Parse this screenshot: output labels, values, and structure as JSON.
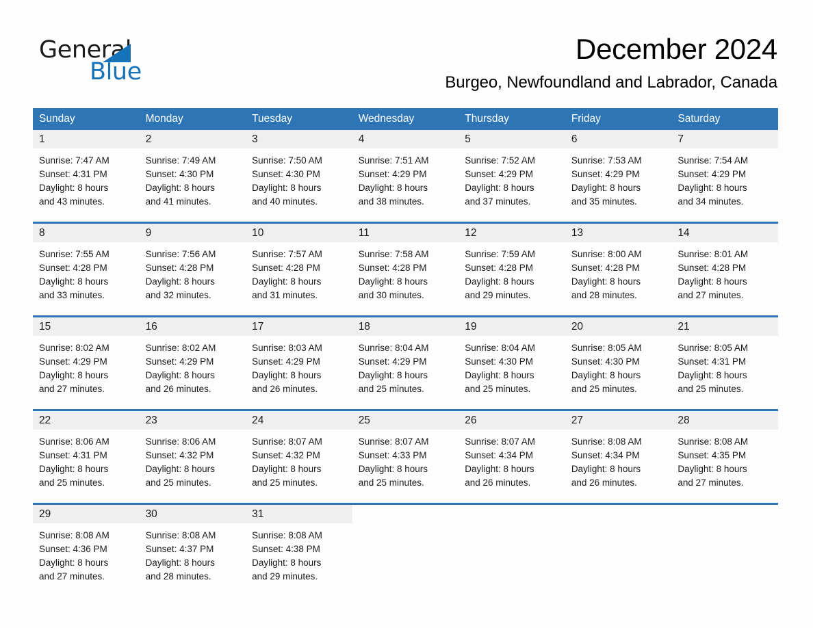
{
  "brand": {
    "name_part1": "General",
    "name_part2": "Blue",
    "logo_triangle_color": "#1673b8"
  },
  "header": {
    "month_title": "December 2024",
    "location": "Burgeo, Newfoundland and Labrador, Canada"
  },
  "theme": {
    "header_blue": "#2e75b6",
    "daynum_band": "#efefef",
    "page_background": "#fdfdfd",
    "text": "#1a1a1a"
  },
  "calendar": {
    "weekdays": [
      "Sunday",
      "Monday",
      "Tuesday",
      "Wednesday",
      "Thursday",
      "Friday",
      "Saturday"
    ],
    "weeks": [
      [
        {
          "day": "1",
          "sunrise": "Sunrise: 7:47 AM",
          "sunset": "Sunset: 4:31 PM",
          "daylight_line1": "Daylight: 8 hours",
          "daylight_line2": "and 43 minutes."
        },
        {
          "day": "2",
          "sunrise": "Sunrise: 7:49 AM",
          "sunset": "Sunset: 4:30 PM",
          "daylight_line1": "Daylight: 8 hours",
          "daylight_line2": "and 41 minutes."
        },
        {
          "day": "3",
          "sunrise": "Sunrise: 7:50 AM",
          "sunset": "Sunset: 4:30 PM",
          "daylight_line1": "Daylight: 8 hours",
          "daylight_line2": "and 40 minutes."
        },
        {
          "day": "4",
          "sunrise": "Sunrise: 7:51 AM",
          "sunset": "Sunset: 4:29 PM",
          "daylight_line1": "Daylight: 8 hours",
          "daylight_line2": "and 38 minutes."
        },
        {
          "day": "5",
          "sunrise": "Sunrise: 7:52 AM",
          "sunset": "Sunset: 4:29 PM",
          "daylight_line1": "Daylight: 8 hours",
          "daylight_line2": "and 37 minutes."
        },
        {
          "day": "6",
          "sunrise": "Sunrise: 7:53 AM",
          "sunset": "Sunset: 4:29 PM",
          "daylight_line1": "Daylight: 8 hours",
          "daylight_line2": "and 35 minutes."
        },
        {
          "day": "7",
          "sunrise": "Sunrise: 7:54 AM",
          "sunset": "Sunset: 4:29 PM",
          "daylight_line1": "Daylight: 8 hours",
          "daylight_line2": "and 34 minutes."
        }
      ],
      [
        {
          "day": "8",
          "sunrise": "Sunrise: 7:55 AM",
          "sunset": "Sunset: 4:28 PM",
          "daylight_line1": "Daylight: 8 hours",
          "daylight_line2": "and 33 minutes."
        },
        {
          "day": "9",
          "sunrise": "Sunrise: 7:56 AM",
          "sunset": "Sunset: 4:28 PM",
          "daylight_line1": "Daylight: 8 hours",
          "daylight_line2": "and 32 minutes."
        },
        {
          "day": "10",
          "sunrise": "Sunrise: 7:57 AM",
          "sunset": "Sunset: 4:28 PM",
          "daylight_line1": "Daylight: 8 hours",
          "daylight_line2": "and 31 minutes."
        },
        {
          "day": "11",
          "sunrise": "Sunrise: 7:58 AM",
          "sunset": "Sunset: 4:28 PM",
          "daylight_line1": "Daylight: 8 hours",
          "daylight_line2": "and 30 minutes."
        },
        {
          "day": "12",
          "sunrise": "Sunrise: 7:59 AM",
          "sunset": "Sunset: 4:28 PM",
          "daylight_line1": "Daylight: 8 hours",
          "daylight_line2": "and 29 minutes."
        },
        {
          "day": "13",
          "sunrise": "Sunrise: 8:00 AM",
          "sunset": "Sunset: 4:28 PM",
          "daylight_line1": "Daylight: 8 hours",
          "daylight_line2": "and 28 minutes."
        },
        {
          "day": "14",
          "sunrise": "Sunrise: 8:01 AM",
          "sunset": "Sunset: 4:28 PM",
          "daylight_line1": "Daylight: 8 hours",
          "daylight_line2": "and 27 minutes."
        }
      ],
      [
        {
          "day": "15",
          "sunrise": "Sunrise: 8:02 AM",
          "sunset": "Sunset: 4:29 PM",
          "daylight_line1": "Daylight: 8 hours",
          "daylight_line2": "and 27 minutes."
        },
        {
          "day": "16",
          "sunrise": "Sunrise: 8:02 AM",
          "sunset": "Sunset: 4:29 PM",
          "daylight_line1": "Daylight: 8 hours",
          "daylight_line2": "and 26 minutes."
        },
        {
          "day": "17",
          "sunrise": "Sunrise: 8:03 AM",
          "sunset": "Sunset: 4:29 PM",
          "daylight_line1": "Daylight: 8 hours",
          "daylight_line2": "and 26 minutes."
        },
        {
          "day": "18",
          "sunrise": "Sunrise: 8:04 AM",
          "sunset": "Sunset: 4:29 PM",
          "daylight_line1": "Daylight: 8 hours",
          "daylight_line2": "and 25 minutes."
        },
        {
          "day": "19",
          "sunrise": "Sunrise: 8:04 AM",
          "sunset": "Sunset: 4:30 PM",
          "daylight_line1": "Daylight: 8 hours",
          "daylight_line2": "and 25 minutes."
        },
        {
          "day": "20",
          "sunrise": "Sunrise: 8:05 AM",
          "sunset": "Sunset: 4:30 PM",
          "daylight_line1": "Daylight: 8 hours",
          "daylight_line2": "and 25 minutes."
        },
        {
          "day": "21",
          "sunrise": "Sunrise: 8:05 AM",
          "sunset": "Sunset: 4:31 PM",
          "daylight_line1": "Daylight: 8 hours",
          "daylight_line2": "and 25 minutes."
        }
      ],
      [
        {
          "day": "22",
          "sunrise": "Sunrise: 8:06 AM",
          "sunset": "Sunset: 4:31 PM",
          "daylight_line1": "Daylight: 8 hours",
          "daylight_line2": "and 25 minutes."
        },
        {
          "day": "23",
          "sunrise": "Sunrise: 8:06 AM",
          "sunset": "Sunset: 4:32 PM",
          "daylight_line1": "Daylight: 8 hours",
          "daylight_line2": "and 25 minutes."
        },
        {
          "day": "24",
          "sunrise": "Sunrise: 8:07 AM",
          "sunset": "Sunset: 4:32 PM",
          "daylight_line1": "Daylight: 8 hours",
          "daylight_line2": "and 25 minutes."
        },
        {
          "day": "25",
          "sunrise": "Sunrise: 8:07 AM",
          "sunset": "Sunset: 4:33 PM",
          "daylight_line1": "Daylight: 8 hours",
          "daylight_line2": "and 25 minutes."
        },
        {
          "day": "26",
          "sunrise": "Sunrise: 8:07 AM",
          "sunset": "Sunset: 4:34 PM",
          "daylight_line1": "Daylight: 8 hours",
          "daylight_line2": "and 26 minutes."
        },
        {
          "day": "27",
          "sunrise": "Sunrise: 8:08 AM",
          "sunset": "Sunset: 4:34 PM",
          "daylight_line1": "Daylight: 8 hours",
          "daylight_line2": "and 26 minutes."
        },
        {
          "day": "28",
          "sunrise": "Sunrise: 8:08 AM",
          "sunset": "Sunset: 4:35 PM",
          "daylight_line1": "Daylight: 8 hours",
          "daylight_line2": "and 27 minutes."
        }
      ],
      [
        {
          "day": "29",
          "sunrise": "Sunrise: 8:08 AM",
          "sunset": "Sunset: 4:36 PM",
          "daylight_line1": "Daylight: 8 hours",
          "daylight_line2": "and 27 minutes."
        },
        {
          "day": "30",
          "sunrise": "Sunrise: 8:08 AM",
          "sunset": "Sunset: 4:37 PM",
          "daylight_line1": "Daylight: 8 hours",
          "daylight_line2": "and 28 minutes."
        },
        {
          "day": "31",
          "sunrise": "Sunrise: 8:08 AM",
          "sunset": "Sunset: 4:38 PM",
          "daylight_line1": "Daylight: 8 hours",
          "daylight_line2": "and 29 minutes."
        },
        {
          "day": "",
          "sunrise": "",
          "sunset": "",
          "daylight_line1": "",
          "daylight_line2": ""
        },
        {
          "day": "",
          "sunrise": "",
          "sunset": "",
          "daylight_line1": "",
          "daylight_line2": ""
        },
        {
          "day": "",
          "sunrise": "",
          "sunset": "",
          "daylight_line1": "",
          "daylight_line2": ""
        },
        {
          "day": "",
          "sunrise": "",
          "sunset": "",
          "daylight_line1": "",
          "daylight_line2": ""
        }
      ]
    ]
  }
}
